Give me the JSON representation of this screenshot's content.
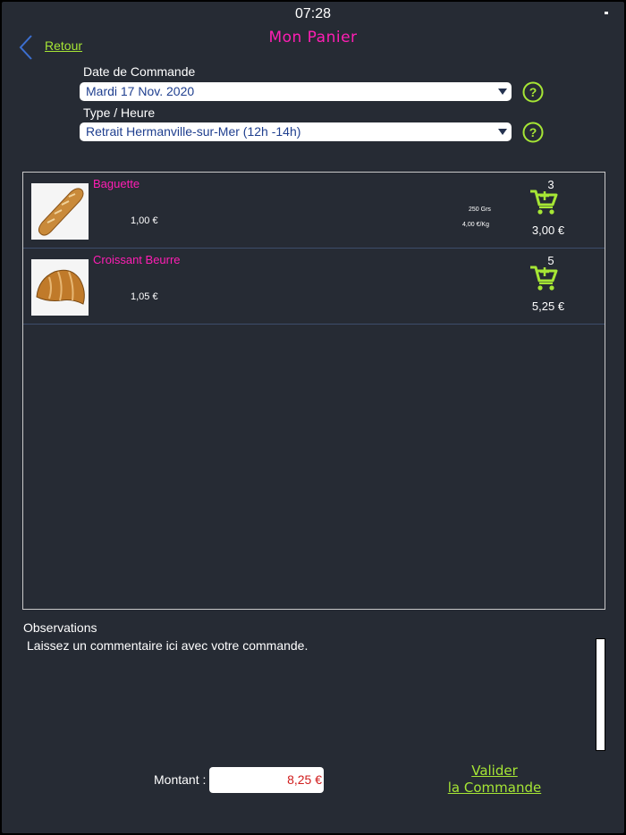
{
  "status_bar": {
    "time": "07:28"
  },
  "header": {
    "back_label": "Retour",
    "title": "Mon Panier"
  },
  "order_date": {
    "label": "Date de Commande",
    "value": "Mardi 17 Nov. 2020"
  },
  "order_type": {
    "label": "Type / Heure",
    "value": "Retrait Hermanville-sur-Mer (12h -14h)"
  },
  "cart": {
    "items": [
      {
        "name": "Baguette",
        "unit_price": "1,00 €",
        "weight": "250 Grs",
        "price_per_kg": "4,00 €/Kg",
        "quantity": "3",
        "total": "3,00 €",
        "icon": "cart-icon"
      },
      {
        "name": "Croissant Beurre",
        "unit_price": "1,05 €",
        "quantity": "5",
        "total": "5,25 €",
        "icon": "cart-icon"
      }
    ]
  },
  "observations": {
    "label": "Observations",
    "placeholder": "Laissez un commentaire ici avec votre commande."
  },
  "footer": {
    "amount_label": "Montant :",
    "amount_value": "8,25 €",
    "validate_line1": "Valider",
    "validate_line2": "la Commande"
  },
  "colors": {
    "background": "#262b34",
    "title": "#ff1eb4",
    "accent": "#a6e635",
    "select_text": "#1f3f8f",
    "amount_text": "#d01c1c"
  }
}
